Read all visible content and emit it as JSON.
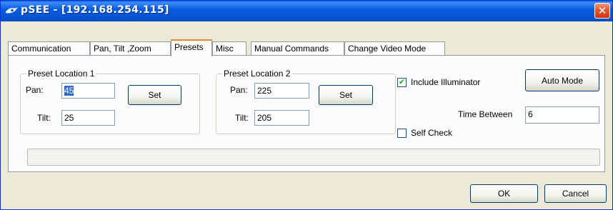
{
  "window": {
    "title": "pSEE - [192.168.254.115]",
    "close_glyph": "✕",
    "icon": "app-eye-icon"
  },
  "tabs": [
    {
      "label": "Communication",
      "active": false
    },
    {
      "label": "Pan, Tilt ,Zoom",
      "active": false
    },
    {
      "label": "Presets",
      "active": true
    },
    {
      "label": "Misc",
      "active": false
    },
    {
      "label": "Manual Commands",
      "active": false
    },
    {
      "label": "Change Video Mode",
      "active": false
    }
  ],
  "presets": {
    "location1": {
      "title": "Preset Location 1",
      "pan_label": "Pan:",
      "pan_value": "45",
      "tilt_label": "Tilt:",
      "tilt_value": "25",
      "set_label": "Set"
    },
    "location2": {
      "title": "Preset Location 2",
      "pan_label": "Pan:",
      "pan_value": "225",
      "tilt_label": "Tilt:",
      "tilt_value": "205",
      "set_label": "Set"
    },
    "include_illuminator": {
      "label": "Include Illuminator",
      "checked": true,
      "mark": "✔"
    },
    "auto_mode_label": "Auto Mode",
    "time_between": {
      "label": "Time Between",
      "value": "6"
    },
    "self_check": {
      "label": "Self Check",
      "checked": false
    },
    "progress": 0
  },
  "footer": {
    "ok_label": "OK",
    "cancel_label": "Cancel"
  }
}
